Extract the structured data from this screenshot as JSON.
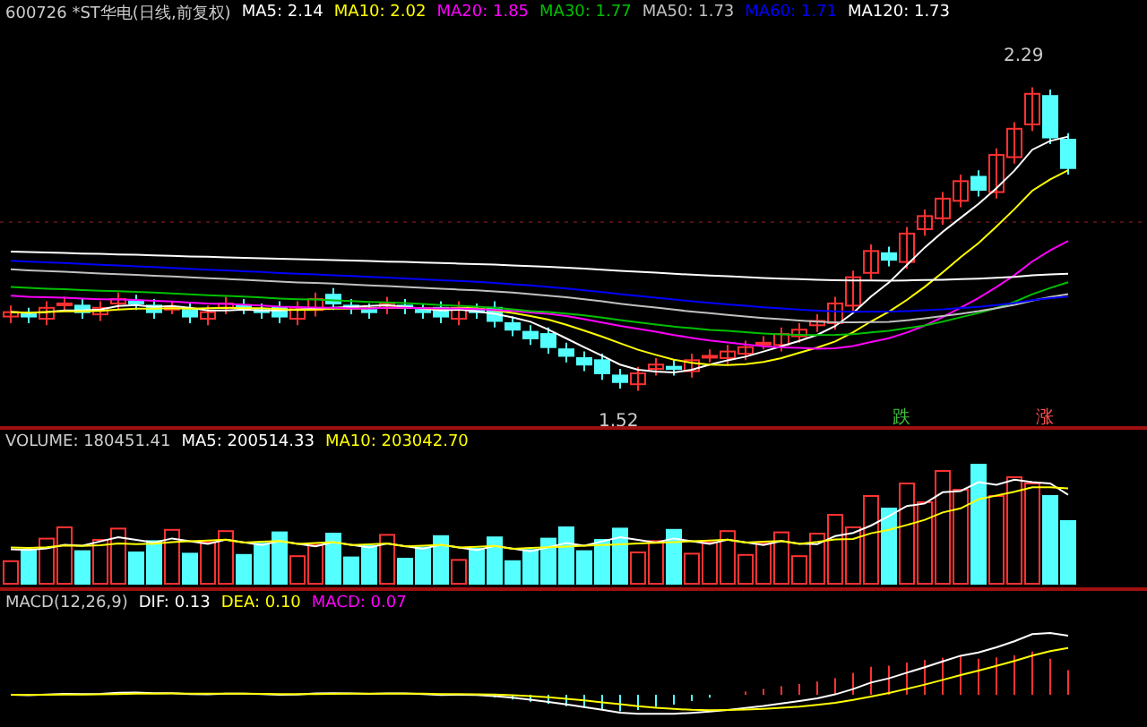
{
  "main_panel": {
    "title": "600726 *ST华电(日线,前复权)",
    "indicators": [
      {
        "label": "MA5: 2.14",
        "color": "#ffffff"
      },
      {
        "label": "MA10: 2.02",
        "color": "#ffff00"
      },
      {
        "label": "MA20: 1.85",
        "color": "#ff00ff"
      },
      {
        "label": "MA30: 1.77",
        "color": "#00c000"
      },
      {
        "label": "MA50: 1.73",
        "color": "#c0c0c0"
      },
      {
        "label": "MA60: 1.71",
        "color": "#0000ff"
      },
      {
        "label": "MA120: 1.73",
        "color": "#ffffff"
      }
    ],
    "high_label": "2.29",
    "low_label": "1.52",
    "markers": [
      {
        "text": "跌",
        "color": "#40c040"
      },
      {
        "text": "涨",
        "color": "#ff5050"
      }
    ]
  },
  "volume_panel": {
    "title": "VOLUME: 180451.41",
    "indicators": [
      {
        "label": "MA5: 200514.33",
        "color": "#ffffff"
      },
      {
        "label": "MA10: 203042.70",
        "color": "#ffff00"
      }
    ]
  },
  "macd_panel": {
    "title": "MACD(12,26,9)",
    "indicators": [
      {
        "label": "DIF: 0.13",
        "color": "#ffffff"
      },
      {
        "label": "DEA: 0.10",
        "color": "#ffff00"
      },
      {
        "label": "MACD: 0.07",
        "color": "#ff00ff"
      }
    ]
  }
}
